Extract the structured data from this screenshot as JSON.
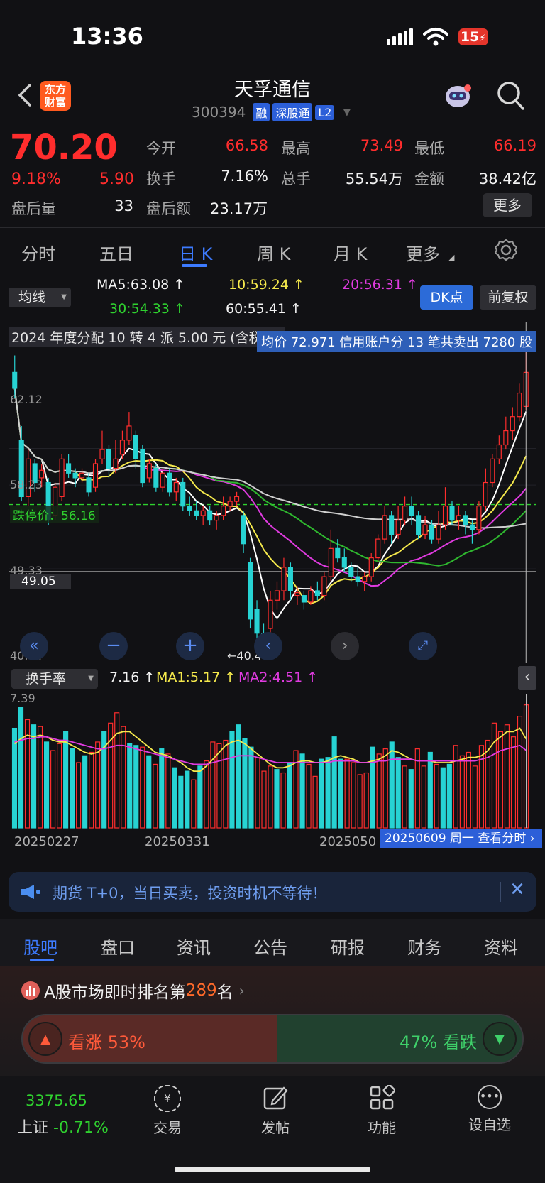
{
  "status_bar": {
    "time": "13:36",
    "battery": "15"
  },
  "header": {
    "logo_line1": "东方",
    "logo_line2": "财富",
    "title": "天孚通信",
    "code": "300394",
    "tags": [
      "融",
      "深股通",
      "L2"
    ]
  },
  "quote": {
    "price": "70.20",
    "change_pct": "9.18%",
    "change": "5.90",
    "after_hours_volume_label": "盘后量",
    "after_hours_volume": "33",
    "open_label": "今开",
    "open": "66.58",
    "high_label": "最高",
    "high": "73.49",
    "low_label": "最低",
    "low": "66.19",
    "turnover_label": "换手",
    "turnover": "7.16%",
    "total_hands_label": "总手",
    "total_hands": "55.54万",
    "amount_label": "金额",
    "amount": "38.42亿",
    "after_hours_amount_label": "盘后额",
    "after_hours_amount": "23.17万",
    "more_button": "更多"
  },
  "period_tabs": [
    "分时",
    "五日",
    "日 K",
    "周 K",
    "月 K",
    "更多"
  ],
  "active_period": "日 K",
  "ma": {
    "selector": "均线",
    "ma5": "MA5:63.08",
    "ma10": "10:59.24",
    "ma20": "20:56.31",
    "ma30": "30:54.33",
    "ma60": "60:55.41",
    "dk_button": "DK点",
    "adjust_button": "前复权"
  },
  "chart_annotations": {
    "dividend": "2024 年度分配 10 转 4 派 5.00 元 (含税) ▷",
    "credit_note": "均价 72.971 信用账户分 13 笔共卖出 7280 股",
    "limit_down_label": "跌停价：56.16",
    "price_ref": "49.05",
    "low_marker": "←40.44"
  },
  "colors": {
    "up": "#ff2d2d",
    "down": "#27d3d3",
    "ma5": "#ffffff",
    "ma10": "#f5e94c",
    "ma20": "#e03be0",
    "ma30": "#2fb82f",
    "ma60": "#d0d0d0",
    "accent": "#3d7bff"
  },
  "chart_data": [
    {
      "type": "candlestick",
      "y_axis_ticks": [
        "62.12",
        "58.23",
        "49.33",
        "40.44"
      ],
      "ylim": [
        40.44,
        74
      ],
      "reference_lines": [
        {
          "label": "跌停价：56.16",
          "value": 56.16
        },
        {
          "label": "49.05",
          "value": 49.05
        }
      ],
      "candles": [
        {
          "o": 70.2,
          "c": 68.5,
          "h": 72.0,
          "l": 67.5
        },
        {
          "o": 63.0,
          "c": 57.0,
          "h": 64.5,
          "l": 56.5
        },
        {
          "o": 57.0,
          "c": 61.0,
          "h": 62.0,
          "l": 56.0
        },
        {
          "o": 60.5,
          "c": 58.5,
          "h": 61.0,
          "l": 57.5
        },
        {
          "o": 59.0,
          "c": 59.8,
          "h": 60.5,
          "l": 58.0
        },
        {
          "o": 58.5,
          "c": 54.5,
          "h": 59.0,
          "l": 54.0
        },
        {
          "o": 55.0,
          "c": 58.0,
          "h": 58.5,
          "l": 54.5
        },
        {
          "o": 57.0,
          "c": 61.0,
          "h": 61.5,
          "l": 56.5
        },
        {
          "o": 60.5,
          "c": 59.5,
          "h": 61.5,
          "l": 59.0
        },
        {
          "o": 59.5,
          "c": 59.0,
          "h": 60.0,
          "l": 58.0
        },
        {
          "o": 59.0,
          "c": 59.5,
          "h": 60.0,
          "l": 58.5
        },
        {
          "o": 59.0,
          "c": 57.5,
          "h": 59.5,
          "l": 57.0
        },
        {
          "o": 58.0,
          "c": 60.5,
          "h": 61.0,
          "l": 57.5
        },
        {
          "o": 61.0,
          "c": 62.0,
          "h": 64.0,
          "l": 60.5
        },
        {
          "o": 62.0,
          "c": 60.0,
          "h": 62.5,
          "l": 59.0
        },
        {
          "o": 60.0,
          "c": 61.0,
          "h": 63.0,
          "l": 59.5
        },
        {
          "o": 61.5,
          "c": 63.0,
          "h": 64.0,
          "l": 61.0
        },
        {
          "o": 63.0,
          "c": 64.5,
          "h": 66.0,
          "l": 62.5
        },
        {
          "o": 63.5,
          "c": 61.0,
          "h": 64.0,
          "l": 60.0
        },
        {
          "o": 62.0,
          "c": 58.5,
          "h": 62.5,
          "l": 58.0
        },
        {
          "o": 59.0,
          "c": 60.5,
          "h": 61.0,
          "l": 58.5
        },
        {
          "o": 60.0,
          "c": 58.0,
          "h": 60.5,
          "l": 57.5
        },
        {
          "o": 58.0,
          "c": 59.5,
          "h": 60.0,
          "l": 57.5
        },
        {
          "o": 59.5,
          "c": 57.5,
          "h": 60.0,
          "l": 57.0
        },
        {
          "o": 57.5,
          "c": 58.5,
          "h": 59.0,
          "l": 56.5
        },
        {
          "o": 58.5,
          "c": 56.0,
          "h": 59.0,
          "l": 55.5
        },
        {
          "o": 56.0,
          "c": 55.5,
          "h": 57.0,
          "l": 55.0
        },
        {
          "o": 55.5,
          "c": 55.0,
          "h": 56.5,
          "l": 54.5
        },
        {
          "o": 55.0,
          "c": 55.5,
          "h": 56.0,
          "l": 54.0
        },
        {
          "o": 55.5,
          "c": 54.5,
          "h": 56.0,
          "l": 54.0
        },
        {
          "o": 54.5,
          "c": 55.0,
          "h": 55.5,
          "l": 53.5
        },
        {
          "o": 55.0,
          "c": 56.0,
          "h": 57.0,
          "l": 54.5
        },
        {
          "o": 56.0,
          "c": 56.5,
          "h": 57.0,
          "l": 55.5
        },
        {
          "o": 56.5,
          "c": 57.0,
          "h": 57.5,
          "l": 56.0
        },
        {
          "o": 55.0,
          "c": 52.0,
          "h": 55.5,
          "l": 51.0
        },
        {
          "o": 50.0,
          "c": 44.0,
          "h": 50.5,
          "l": 43.0
        },
        {
          "o": 45.0,
          "c": 42.5,
          "h": 46.0,
          "l": 41.5
        },
        {
          "o": 42.5,
          "c": 40.8,
          "h": 43.5,
          "l": 40.44
        },
        {
          "o": 43.0,
          "c": 46.0,
          "h": 47.0,
          "l": 42.5
        },
        {
          "o": 46.0,
          "c": 47.0,
          "h": 48.0,
          "l": 45.0
        },
        {
          "o": 47.0,
          "c": 49.5,
          "h": 50.5,
          "l": 46.0
        },
        {
          "o": 49.5,
          "c": 47.0,
          "h": 50.0,
          "l": 46.0
        },
        {
          "o": 46.5,
          "c": 46.8,
          "h": 47.5,
          "l": 45.5
        },
        {
          "o": 46.5,
          "c": 45.8,
          "h": 47.0,
          "l": 45.0
        },
        {
          "o": 45.8,
          "c": 47.0,
          "h": 47.5,
          "l": 45.5
        },
        {
          "o": 47.0,
          "c": 46.5,
          "h": 48.0,
          "l": 46.0
        },
        {
          "o": 46.5,
          "c": 48.5,
          "h": 49.0,
          "l": 46.0
        },
        {
          "o": 48.5,
          "c": 51.5,
          "h": 53.5,
          "l": 48.0
        },
        {
          "o": 51.5,
          "c": 50.5,
          "h": 52.5,
          "l": 50.0
        },
        {
          "o": 50.5,
          "c": 49.5,
          "h": 51.5,
          "l": 49.0
        },
        {
          "o": 49.5,
          "c": 48.5,
          "h": 50.0,
          "l": 48.0
        },
        {
          "o": 48.5,
          "c": 48.0,
          "h": 49.5,
          "l": 47.5
        },
        {
          "o": 48.0,
          "c": 48.5,
          "h": 49.0,
          "l": 47.0
        },
        {
          "o": 48.5,
          "c": 50.5,
          "h": 51.0,
          "l": 48.0
        },
        {
          "o": 50.5,
          "c": 52.5,
          "h": 53.0,
          "l": 50.0
        },
        {
          "o": 52.5,
          "c": 55.0,
          "h": 56.0,
          "l": 52.0
        },
        {
          "o": 55.0,
          "c": 53.0,
          "h": 55.5,
          "l": 52.0
        },
        {
          "o": 53.0,
          "c": 54.5,
          "h": 56.0,
          "l": 52.5
        },
        {
          "o": 54.5,
          "c": 56.0,
          "h": 57.0,
          "l": 54.0
        },
        {
          "o": 56.0,
          "c": 55.0,
          "h": 57.0,
          "l": 54.0
        },
        {
          "o": 55.0,
          "c": 53.0,
          "h": 55.5,
          "l": 52.5
        },
        {
          "o": 53.0,
          "c": 54.0,
          "h": 55.0,
          "l": 52.5
        },
        {
          "o": 54.0,
          "c": 52.5,
          "h": 54.5,
          "l": 52.0
        },
        {
          "o": 52.5,
          "c": 54.0,
          "h": 55.5,
          "l": 52.0
        },
        {
          "o": 54.0,
          "c": 56.0,
          "h": 58.0,
          "l": 53.5
        },
        {
          "o": 56.0,
          "c": 54.5,
          "h": 56.5,
          "l": 54.0
        },
        {
          "o": 54.5,
          "c": 55.0,
          "h": 56.0,
          "l": 53.5
        },
        {
          "o": 55.0,
          "c": 54.0,
          "h": 55.5,
          "l": 53.0
        },
        {
          "o": 54.0,
          "c": 53.5,
          "h": 54.5,
          "l": 52.0
        },
        {
          "o": 53.5,
          "c": 56.0,
          "h": 56.5,
          "l": 53.0
        },
        {
          "o": 56.0,
          "c": 58.5,
          "h": 60.0,
          "l": 55.5
        },
        {
          "o": 58.5,
          "c": 61.0,
          "h": 61.5,
          "l": 58.0
        },
        {
          "o": 61.0,
          "c": 62.5,
          "h": 63.5,
          "l": 60.5
        },
        {
          "o": 62.5,
          "c": 64.0,
          "h": 65.5,
          "l": 62.0
        },
        {
          "o": 64.0,
          "c": 65.5,
          "h": 66.5,
          "l": 63.0
        },
        {
          "o": 65.5,
          "c": 68.0,
          "h": 69.0,
          "l": 65.0
        },
        {
          "o": 66.58,
          "c": 70.2,
          "h": 73.49,
          "l": 66.19
        }
      ]
    },
    {
      "type": "bar",
      "title": "换手率",
      "values_labels": {
        "current": "7.16",
        "ma1": "MA1:5.17",
        "ma2": "MA2:4.51"
      },
      "y_axis_ticks": [
        "7.39"
      ],
      "x_tick_labels": [
        "20250227",
        "20250331",
        "2025050"
      ],
      "cursor_label": "20250609 周一 查看分时",
      "values": [
        5.8,
        7.0,
        6.3,
        6.0,
        5.9,
        5.0,
        4.5,
        4.9,
        5.6,
        4.6,
        3.8,
        4.2,
        4.4,
        5.0,
        5.6,
        6.1,
        6.7,
        5.9,
        4.9,
        4.8,
        4.7,
        4.2,
        3.7,
        4.6,
        4.3,
        3.5,
        3.0,
        3.3,
        2.8,
        3.6,
        3.9,
        5.0,
        4.9,
        5.1,
        5.6,
        6.0,
        5.2,
        4.7,
        4.1,
        3.3,
        3.6,
        3.4,
        3.2,
        3.8,
        4.5,
        4.3,
        3.7,
        3.0,
        4.0,
        4.1,
        5.3,
        4.0,
        4.0,
        3.8,
        3.1,
        3.2,
        4.7,
        4.3,
        4.6,
        5.0,
        4.1,
        3.6,
        3.4,
        4.6,
        3.6,
        4.4,
        3.7,
        3.5,
        3.7,
        4.8,
        4.2,
        4.4,
        3.6,
        4.8,
        5.1,
        6.1,
        5.6,
        6.0,
        5.3,
        6.5,
        7.16
      ],
      "ma1": [
        4.9,
        5.2,
        5.4,
        5.3,
        5.4,
        5.3,
        5.1,
        5.0,
        5.0,
        4.8,
        4.6,
        4.4,
        4.3,
        4.4,
        4.7,
        5.1,
        5.5,
        5.6,
        5.6,
        5.3,
        5.0,
        4.7,
        4.4,
        4.3,
        4.2,
        4.0,
        3.8,
        3.5,
        3.3,
        3.3,
        3.6,
        4.0,
        4.4,
        4.8,
        5.0,
        5.1,
        4.9,
        4.6,
        4.3,
        4.0,
        3.7,
        3.5,
        3.5,
        3.6,
        3.8,
        3.9,
        3.9,
        3.8,
        3.8,
        3.9,
        4.1,
        4.2,
        4.1,
        4.0,
        3.8,
        3.8,
        3.9,
        4.0,
        4.2,
        4.5,
        4.4,
        4.2,
        4.0,
        3.9,
        3.9,
        3.9,
        3.8,
        3.8,
        3.8,
        3.9,
        4.0,
        4.1,
        4.1,
        4.2,
        4.5,
        5.0,
        5.3,
        5.6,
        5.6,
        5.8,
        5.17
      ],
      "ma2": [
        5.0,
        5.1,
        5.2,
        5.2,
        5.3,
        5.3,
        5.2,
        5.1,
        5.1,
        5.0,
        4.9,
        4.8,
        4.7,
        4.6,
        4.6,
        4.7,
        4.8,
        4.8,
        4.7,
        4.6,
        4.5,
        4.4,
        4.3,
        4.2,
        4.1,
        4.0,
        3.9,
        3.8,
        3.7,
        3.7,
        3.7,
        3.8,
        3.9,
        4.0,
        4.1,
        4.2,
        4.2,
        4.2,
        4.1,
        4.0,
        3.9,
        3.8,
        3.8,
        3.8,
        3.8,
        3.8,
        3.8,
        3.8,
        3.8,
        3.8,
        3.9,
        3.9,
        3.9,
        3.9,
        3.8,
        3.8,
        3.8,
        3.9,
        3.9,
        4.0,
        4.0,
        4.0,
        4.0,
        3.9,
        3.9,
        3.9,
        3.9,
        3.9,
        3.9,
        3.9,
        3.9,
        3.9,
        3.9,
        4.0,
        4.1,
        4.3,
        4.5,
        4.6,
        4.7,
        4.8,
        4.51
      ]
    }
  ],
  "notice": {
    "text": "期货 T+0，当日买卖，投资时机不等待！"
  },
  "bottom_tabs": [
    "股吧",
    "盘口",
    "资讯",
    "公告",
    "研报",
    "财务",
    "资料"
  ],
  "active_bottom_tab": "股吧",
  "ranking": {
    "prefix": "A股市场即时排名第",
    "rank": "289",
    "suffix": "名"
  },
  "sentiment": {
    "bull_label": "看涨",
    "bull_pct": "53%",
    "bear_pct": "47%",
    "bear_label": "看跌",
    "bull_fraction": 0.53
  },
  "bottom_nav": {
    "index_value": "3375.65",
    "index_name": "上证",
    "index_change": "-0.71%",
    "items": [
      "交易",
      "发帖",
      "功能",
      "设自选"
    ]
  }
}
